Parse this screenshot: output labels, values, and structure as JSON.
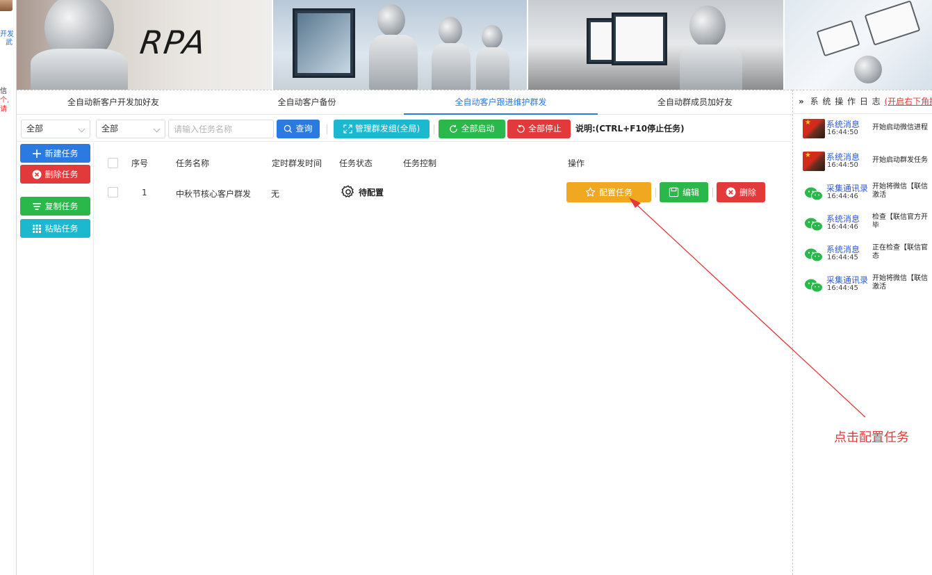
{
  "left_strip": {
    "line1": "开发",
    "line2": "武",
    "line3": "信",
    "line4": "个,",
    "line5": "请"
  },
  "banner": {
    "rpa_text": "RPA"
  },
  "tabs": [
    {
      "label": "全自动新客户开发加好友"
    },
    {
      "label": "全自动客户备份"
    },
    {
      "label": "全自动客户跟进维护群发"
    },
    {
      "label": "全自动群成员加好友"
    }
  ],
  "toolbar": {
    "select1_value": "全部",
    "select2_value": "全部",
    "search_placeholder": "请输入任务名称",
    "query_label": "查询",
    "manage_group_label": "管理群发组(全局)",
    "start_all_label": "全部启动",
    "stop_all_label": "全部停止",
    "note": "说明:(CTRL+F10停止任务)"
  },
  "side_buttons": {
    "new_task": "新建任务",
    "delete_task": "删除任务",
    "copy_task": "复制任务",
    "paste_task": "粘贴任务"
  },
  "table": {
    "columns": [
      "序号",
      "任务名称",
      "定时群发时间",
      "任务状态",
      "任务控制",
      "操作"
    ],
    "rows": [
      {
        "index": "1",
        "name": "中秋节核心客户群发",
        "schedule": "无",
        "status": "待配置",
        "control": "",
        "actions": {
          "config": "配置任务",
          "edit": "编辑",
          "delete": "删除"
        }
      }
    ]
  },
  "log": {
    "header_title": "系 统 操 作 日 志",
    "header_link": "(开启右下角提",
    "items": [
      {
        "title": "系统消息",
        "time": "16:44:50",
        "msg1": "开始启动微信进程",
        "msg2": "",
        "avatar": "flag-avatar"
      },
      {
        "title": "系统消息",
        "time": "16:44:50",
        "msg1": "开始启动群发任务",
        "msg2": "",
        "avatar": "flag-avatar"
      },
      {
        "title": "采集通讯录",
        "time": "16:44:46",
        "msg1": "开始将微信【联信",
        "msg2": "激活",
        "avatar": "wechat-icon"
      },
      {
        "title": "系统消息",
        "time": "16:44:46",
        "msg1": "检查【联信官方开",
        "msg2": "毕",
        "avatar": "wechat-icon"
      },
      {
        "title": "系统消息",
        "time": "16:44:45",
        "msg1": "正在检查【联信官",
        "msg2": "态",
        "avatar": "wechat-icon"
      },
      {
        "title": "采集通讯录",
        "time": "16:44:45",
        "msg1": "开始将微信【联信",
        "msg2": "激活",
        "avatar": "wechat-icon"
      }
    ]
  },
  "annotation": {
    "text": "点击配置任务",
    "color": "#e23a3a"
  },
  "colors": {
    "primary": "#2a7ae2",
    "danger": "#e23a3a",
    "success": "#2ab84a",
    "info": "#1cb8d0",
    "warning": "#f0a820"
  }
}
